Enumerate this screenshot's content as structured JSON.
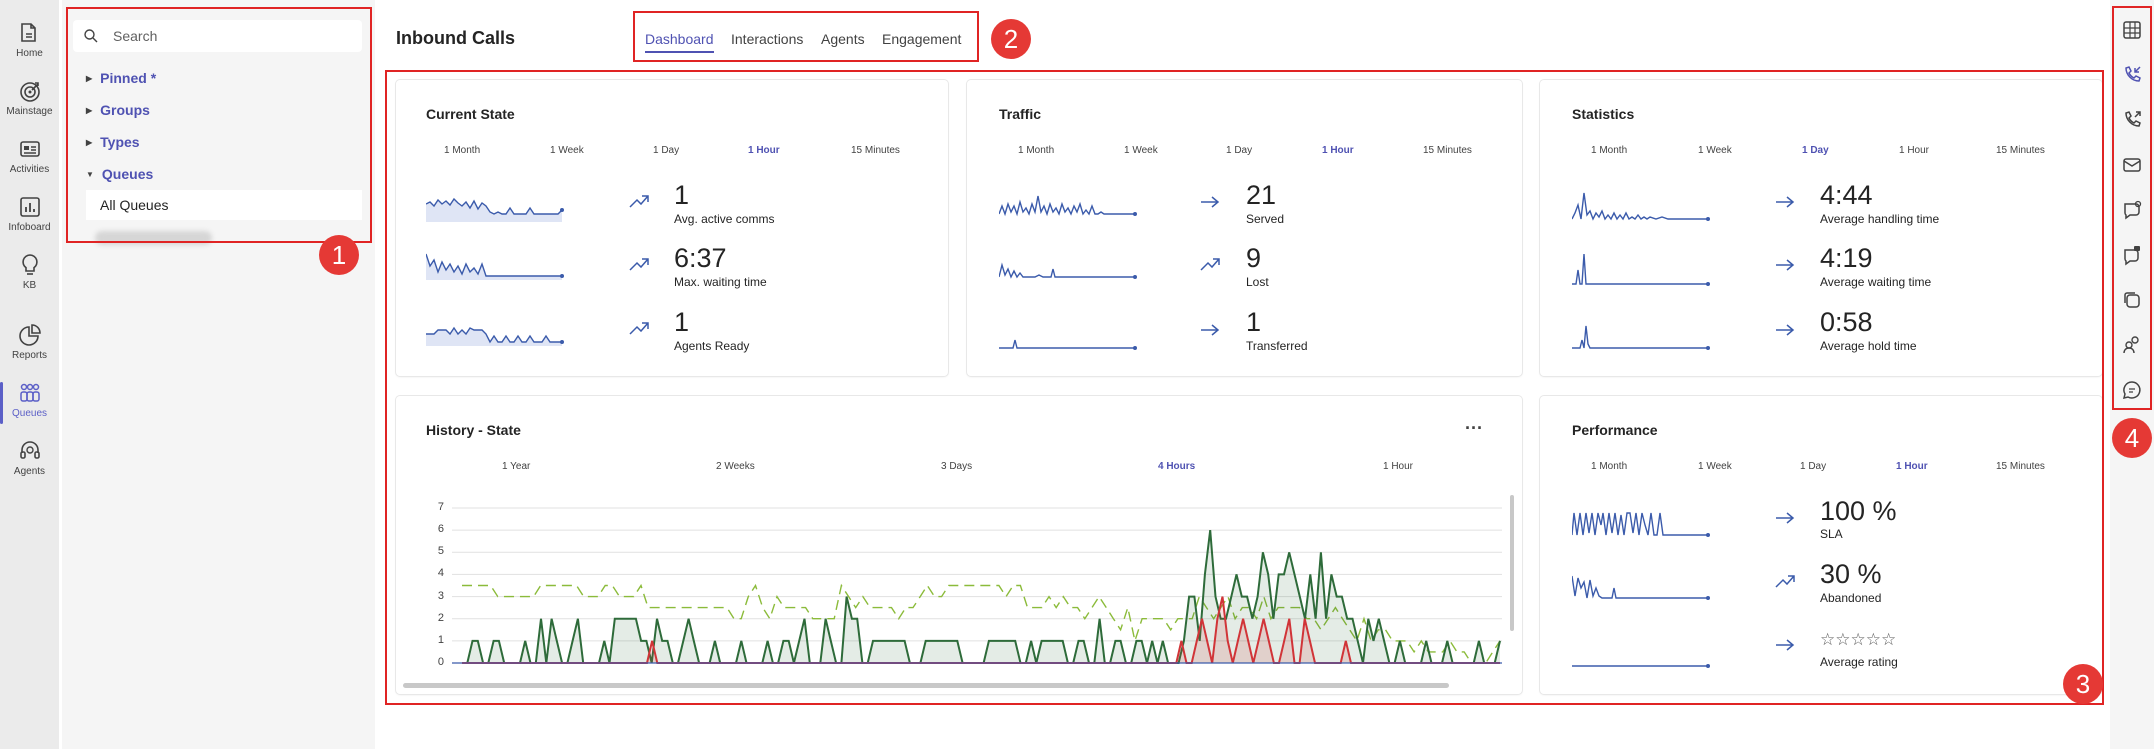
{
  "rail": {
    "items": [
      {
        "label": "Home",
        "icon": "home-icon"
      },
      {
        "label": "Mainstage",
        "icon": "target-icon"
      },
      {
        "label": "Activities",
        "icon": "activities-icon"
      },
      {
        "label": "Infoboard",
        "icon": "chart-icon"
      },
      {
        "label": "KB",
        "icon": "lightbulb-icon"
      },
      {
        "label": "Reports",
        "icon": "pie-icon"
      },
      {
        "label": "Queues",
        "icon": "queues-icon"
      },
      {
        "label": "Agents",
        "icon": "headset-icon"
      }
    ],
    "active": "Queues",
    "accent": "#5b5fc7"
  },
  "nav": {
    "search_placeholder": "Search",
    "tree": [
      {
        "label": "Pinned *",
        "expanded": false
      },
      {
        "label": "Groups",
        "expanded": false
      },
      {
        "label": "Types",
        "expanded": false
      },
      {
        "label": "Queues",
        "expanded": true
      }
    ],
    "selected": "All Queues"
  },
  "header": {
    "title": "Inbound Calls",
    "tabs": [
      "Dashboard",
      "Interactions",
      "Agents",
      "Engagement"
    ],
    "active_tab": "Dashboard"
  },
  "annotations": [
    "1",
    "2",
    "3",
    "4"
  ],
  "cards": {
    "current_state": {
      "title": "Current State",
      "tabs": [
        "1 Month",
        "1 Week",
        "1 Day",
        "1 Hour",
        "15 Minutes"
      ],
      "active_tab": "1 Hour",
      "kpis": [
        {
          "value": "1",
          "label": "Avg. active comms",
          "trend": "up"
        },
        {
          "value": "6:37",
          "label": "Max. waiting time",
          "trend": "up"
        },
        {
          "value": "1",
          "label": "Agents Ready",
          "trend": "up"
        }
      ]
    },
    "traffic": {
      "title": "Traffic",
      "tabs": [
        "1 Month",
        "1 Week",
        "1 Day",
        "1 Hour",
        "15 Minutes"
      ],
      "active_tab": "1 Hour",
      "kpis": [
        {
          "value": "21",
          "label": "Served",
          "trend": "flat"
        },
        {
          "value": "9",
          "label": "Lost",
          "trend": "up"
        },
        {
          "value": "1",
          "label": "Transferred",
          "trend": "flat"
        }
      ]
    },
    "statistics": {
      "title": "Statistics",
      "tabs": [
        "1 Month",
        "1 Week",
        "1 Day",
        "1 Hour",
        "15 Minutes"
      ],
      "active_tab": "1 Day",
      "kpis": [
        {
          "value": "4:44",
          "label": "Average handling time",
          "trend": "flat"
        },
        {
          "value": "4:19",
          "label": "Average waiting time",
          "trend": "flat"
        },
        {
          "value": "0:58",
          "label": "Average hold time",
          "trend": "flat"
        }
      ]
    },
    "history": {
      "title": "History - State",
      "more": "···",
      "tabs": [
        "1 Year",
        "2 Weeks",
        "3 Days",
        "4 Hours",
        "1 Hour"
      ],
      "active_tab": "4 Hours"
    },
    "performance": {
      "title": "Performance",
      "tabs": [
        "1 Month",
        "1 Week",
        "1 Day",
        "1 Hour",
        "15 Minutes"
      ],
      "active_tab": "1 Hour",
      "kpis": [
        {
          "value": "100 %",
          "label": "SLA",
          "trend": "flat"
        },
        {
          "value": "30 %",
          "label": "Abandoned",
          "trend": "up"
        },
        {
          "value": "☆☆☆☆☆",
          "label": "Average rating",
          "trend": "flat"
        }
      ]
    }
  },
  "colors": {
    "accent": "#4f52b2",
    "spark": "#3b5bab",
    "dark_green": "#2e6b3a",
    "light_green": "#8bbb3a",
    "red": "#d13438",
    "annotation": "#e02424"
  },
  "chart_data": {
    "type": "line",
    "title": "History - State",
    "xlabel": "",
    "ylabel": "",
    "ylim": [
      0,
      7
    ],
    "yticks": [
      0,
      1,
      2,
      3,
      4,
      5,
      6,
      7
    ],
    "grid": true,
    "series": [
      {
        "values": [
          3.5,
          3.5,
          3.5,
          3.5,
          3.5,
          3,
          3,
          3,
          3,
          3,
          3,
          3.5,
          3.5,
          3.5,
          3.5,
          3.5,
          3.5,
          3,
          3,
          3,
          3.5,
          3.5,
          3,
          3,
          3,
          3.5,
          2.5,
          2.5,
          2.5,
          2.5,
          2.5,
          2.5,
          2.5,
          2.5,
          2.5,
          2.5,
          2.5,
          2.5,
          2,
          2,
          3,
          3.5,
          2.5,
          2,
          3,
          2.5,
          2.5,
          2.5,
          2.5,
          2,
          2,
          2,
          2,
          3.5,
          3,
          2.5,
          3,
          2.5,
          2.5,
          2.5,
          2.5,
          2,
          2.5,
          2.5,
          3,
          3.5,
          3,
          3,
          3.5,
          3.5,
          3.5,
          3.5,
          3.5,
          3.5,
          3.5,
          3.5,
          3,
          3.5,
          3.5,
          2.5,
          2.5,
          2.5,
          3,
          2.5,
          3,
          2.5,
          2.5,
          2,
          2.5,
          3,
          2.5,
          2,
          1.5,
          2.5,
          1,
          2,
          2,
          2,
          2,
          1.5,
          2,
          2,
          2,
          3,
          2.5,
          2,
          2.5,
          3,
          2,
          2.5,
          2.5,
          2,
          3,
          2,
          2.5,
          2.5,
          2.5,
          2.5,
          2,
          2,
          1.5,
          2,
          2.5,
          2,
          1.5,
          1,
          2,
          1,
          1.5,
          1.5,
          1,
          1,
          1,
          0.5,
          1,
          0.5,
          0.5,
          0.5,
          1,
          0.5,
          0.5,
          0,
          0,
          0,
          0.5,
          1
        ]
      },
      {
        "values": [
          0,
          0,
          1,
          1,
          0,
          0,
          1,
          1,
          0,
          0,
          0,
          0,
          1,
          0,
          0,
          2,
          0,
          2,
          1,
          0,
          0,
          1,
          2,
          0,
          0,
          0,
          0,
          1,
          0,
          2,
          2,
          2,
          2,
          2,
          1,
          1,
          0,
          2,
          1,
          1,
          0,
          0,
          1,
          2,
          1,
          0,
          0,
          0,
          1,
          0,
          0,
          0,
          0,
          1,
          0,
          0,
          0,
          0,
          1,
          0,
          0,
          1,
          1,
          0,
          1,
          2,
          0,
          0,
          0,
          2,
          1,
          0,
          0,
          3,
          2,
          2,
          0,
          0,
          1,
          1,
          1,
          1,
          1,
          1,
          1,
          0,
          0,
          0,
          1,
          1,
          1,
          1,
          1,
          1,
          1,
          0,
          0,
          0,
          0,
          0,
          1,
          1,
          1,
          1,
          1,
          1,
          0,
          0,
          1,
          0,
          1,
          1,
          1,
          1,
          1,
          0,
          0,
          1,
          1,
          0,
          0,
          2,
          0,
          0,
          1,
          1,
          0,
          0,
          1,
          1,
          0,
          1,
          0,
          1,
          0,
          0,
          0,
          1,
          3,
          3,
          1,
          4,
          6,
          3,
          2,
          2,
          3,
          4,
          3,
          3,
          2,
          3,
          5,
          4,
          2,
          4,
          4,
          5,
          4,
          3,
          2,
          4,
          2,
          5,
          2,
          4,
          3,
          3,
          2,
          2,
          1,
          0,
          2,
          1,
          2,
          1,
          0,
          0,
          1,
          0,
          0,
          0,
          0,
          1,
          0,
          0,
          0,
          1,
          0,
          0,
          0,
          0,
          0,
          1,
          0,
          0,
          0,
          1
        ]
      },
      {
        "values": [
          0,
          0,
          0,
          0,
          0,
          0,
          0,
          0,
          0,
          0,
          0,
          0,
          0,
          0,
          0,
          0,
          0,
          0,
          0,
          0,
          0,
          0,
          0,
          0,
          0,
          0,
          0,
          0,
          0,
          0,
          0,
          0,
          0,
          0,
          0,
          0,
          0,
          1,
          0,
          0,
          0,
          0,
          0,
          0,
          0,
          0,
          0,
          0,
          0,
          0,
          0,
          0,
          0,
          0,
          0,
          0,
          0,
          0,
          0,
          0,
          0,
          0,
          0,
          0,
          0,
          0,
          0,
          0,
          0,
          0,
          0,
          0,
          0,
          0,
          0,
          0,
          0,
          0,
          0,
          0,
          0,
          0,
          0,
          0,
          0,
          0,
          0,
          0,
          0,
          0,
          0,
          0,
          0,
          0,
          0,
          0,
          0,
          0,
          0,
          0,
          0,
          0,
          0,
          0,
          0,
          0,
          0,
          0,
          0,
          0,
          0,
          0,
          0,
          0,
          0,
          0,
          0,
          0,
          0,
          0,
          0,
          0,
          0,
          0,
          0,
          0,
          0,
          0,
          0,
          0,
          0,
          0,
          0,
          0,
          0,
          0,
          0,
          0,
          0,
          0,
          1,
          0,
          0,
          1,
          2,
          1,
          0,
          2,
          3,
          1,
          0,
          1,
          2,
          1,
          0,
          1,
          2,
          1,
          0,
          0,
          1,
          2,
          0,
          0,
          2,
          1,
          0,
          0,
          0,
          0,
          0,
          0,
          1,
          0,
          0,
          0,
          0,
          0,
          0,
          0,
          0,
          0,
          0,
          0,
          0,
          0,
          0,
          0,
          0,
          0,
          0,
          0,
          0,
          0,
          0,
          0,
          0,
          0,
          0,
          0,
          0,
          0,
          0
        ]
      }
    ]
  }
}
